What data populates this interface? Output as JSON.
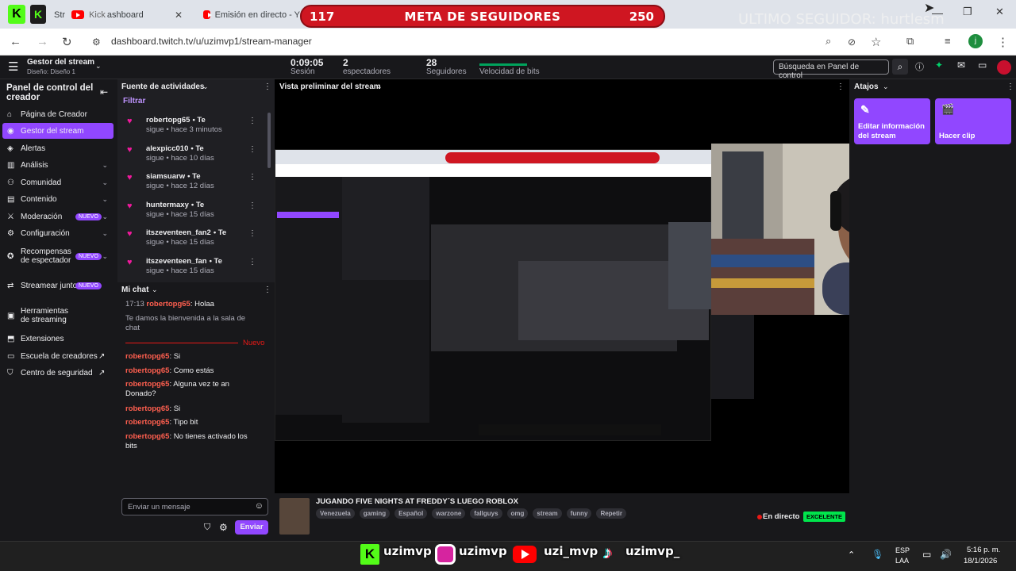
{
  "browser": {
    "tabs": [
      {
        "label": "Str"
      },
      {
        "label": "Kick",
        "extra": "ashboard"
      },
      {
        "label": "Emisión en directo - Y"
      }
    ],
    "url": "dashboard.twitch.tv/u/uzimvp1/stream-manager"
  },
  "overlay": {
    "goal_current": "117",
    "goal_title": "META DE SEGUIDORES",
    "goal_target": "250",
    "last_follower": "ULTIMO SEGUIDOR: hurtlesm"
  },
  "topbar": {
    "manager_title": "Gestor del stream",
    "design": "Diseño: Diseño 1",
    "session_value": "0:09:05",
    "session_label": "Sesión",
    "viewers_value": "2",
    "viewers_label": "espectadores",
    "followers_value": "28",
    "followers_label": "Seguidores",
    "bits_label": "Velocidad de bits",
    "search_placeholder": "Búsqueda en Panel de control"
  },
  "leftnav": {
    "title": "Panel de control del creador",
    "items": [
      {
        "label": "Página de Creador",
        "icon": "home-icon"
      },
      {
        "label": "Gestor del stream",
        "icon": "broadcast-icon",
        "active": true
      },
      {
        "label": "Alertas",
        "icon": "alerts-icon"
      },
      {
        "label": "Análisis",
        "icon": "analytics-icon",
        "chevron": true
      },
      {
        "label": "Comunidad",
        "icon": "community-icon",
        "chevron": true
      },
      {
        "label": "Contenido",
        "icon": "content-icon",
        "chevron": true
      },
      {
        "label": "Moderación",
        "icon": "moderation-icon",
        "chevron": true,
        "badge": "NUEVO"
      },
      {
        "label": "Configuración",
        "icon": "settings-icon",
        "chevron": true
      },
      {
        "label": "Recompensas de espectador",
        "icon": "rewards-icon",
        "chevron": true,
        "badge": "NUEVO"
      },
      {
        "label": "Streamear juntos",
        "icon": "together-icon",
        "badge": "NUEVO"
      },
      {
        "label": "Herramientas de streaming",
        "icon": "tools-icon"
      },
      {
        "label": "Extensiones",
        "icon": "extensions-icon"
      },
      {
        "label": "Escuela de creadores",
        "icon": "school-icon",
        "external": true
      },
      {
        "label": "Centro de seguridad",
        "icon": "safety-icon",
        "external": true
      }
    ]
  },
  "activity": {
    "title": "Fuente de actividades",
    "filter": "Filtrar",
    "items": [
      {
        "name": "robertopg65",
        "action": "• Te",
        "time": "sigue • hace 3 minutos"
      },
      {
        "name": "alexpicc010",
        "action": "• Te",
        "time": "sigue • hace 10 días"
      },
      {
        "name": "siamsuarw",
        "action": "• Te",
        "time": "sigue • hace 12 días"
      },
      {
        "name": "huntermaxy",
        "action": "• Te",
        "time": "sigue • hace 15 días"
      },
      {
        "name": "itszeventeen_fan2",
        "action": "• Te",
        "time": "sigue • hace 15 días"
      },
      {
        "name": "itszeventeen_fan",
        "action": "• Te",
        "time": "sigue • hace 15 días"
      }
    ]
  },
  "chat": {
    "title": "Mi chat",
    "first_time": "17:13",
    "first_user": "robertopg65",
    "first_text": ": Holaa",
    "welcome": "Te damos la bienvenida a la sala de chat",
    "new_label": "Nuevo",
    "messages": [
      {
        "user": "robertopg65",
        "text": ": Si"
      },
      {
        "user": "robertopg65",
        "text": ": Como estás"
      },
      {
        "user": "robertopg65",
        "text": ": Alguna vez te an Donado?"
      },
      {
        "user": "robertopg65",
        "text": ": Si"
      },
      {
        "user": "robertopg65",
        "text": ": Tipo bit"
      },
      {
        "user": "robertopg65",
        "text": ": No tienes activado los bits"
      }
    ],
    "input_placeholder": "Enviar un mensaje",
    "send_label": "Enviar"
  },
  "preview": {
    "title": "Vista preliminar del stream",
    "stream_title": "JUGANDO FIVE NIGHTS AT FREDDY´S LUEGO ROBLOX",
    "tags": [
      "Venezuela",
      "gaming",
      "Español",
      "warzone",
      "fallguys",
      "omg",
      "stream",
      "funny",
      "Repetir"
    ],
    "live_label": "En directo",
    "quality": "EXCELENTE"
  },
  "shortcuts": {
    "title": "Atajos",
    "edit_label": "Editar información del stream",
    "clip_label": "Hacer clip"
  },
  "taskbar": {
    "lang": "ESP",
    "lang2": "LAA",
    "time": "5:16 p. m.",
    "date": "18/1/2026"
  },
  "social": {
    "kick": "uzimvp",
    "instagram": "uzimvp",
    "youtube": "uzi_mvp",
    "tiktok": "uzimvp_"
  },
  "colors": {
    "twitch_purple": "#9147ff",
    "goal_red": "#cf1621",
    "heart": "#f0199d",
    "chat_user": "#ff5f4f",
    "quality_green": "#00e54c"
  }
}
